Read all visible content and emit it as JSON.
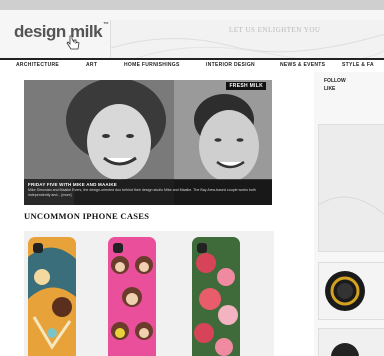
{
  "site": {
    "logo": "design milk",
    "logo_tm": "™",
    "header_ad": "LET US ENLIGHTEN YOU"
  },
  "nav": {
    "items": [
      "ARCHITECTURE",
      "ART",
      "HOME FURNISHINGS",
      "INTERIOR DESIGN",
      "NEWS & EVENTS",
      "STYLE & FA"
    ]
  },
  "hero": {
    "badge": "FRESH MILK",
    "caption_title": "FRIDAY FIVE WITH MIKE AND MAAIKE",
    "caption_body": "Mike Simonian and Maaike Evers, the design-oriented duo behind their design studio Mike and Maaike. The Bay Area-based couple works both independently and... [more]"
  },
  "section": {
    "title": "UNCOMMON IPHONE CASES"
  },
  "sidebar": {
    "links": [
      "FOLLOW",
      "LIKE"
    ]
  },
  "colors": {
    "nav_border": "#222222",
    "case_one": "#e8a23a",
    "case_two": "#e94f9a",
    "case_three": "#d7445a",
    "accent_ring": "#d4a220"
  }
}
